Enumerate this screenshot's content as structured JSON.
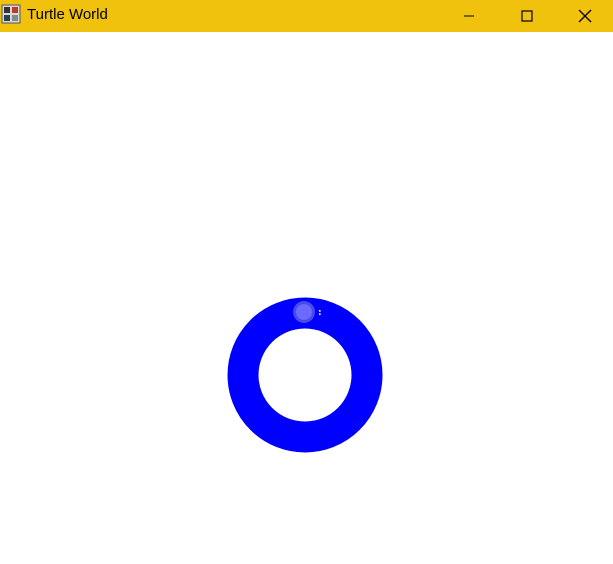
{
  "window": {
    "title": "Turtle World",
    "icon": "turtle-app-icon",
    "controls": {
      "minimize_icon": "minimize-icon",
      "maximize_icon": "maximize-icon",
      "close_icon": "close-icon"
    },
    "titlebar_color": "#f0c20e"
  },
  "canvas": {
    "background": "#ffffff",
    "ring_color": "#0000ff",
    "turtle_color": "#6a6aff",
    "turtle_marker_text": ":"
  }
}
